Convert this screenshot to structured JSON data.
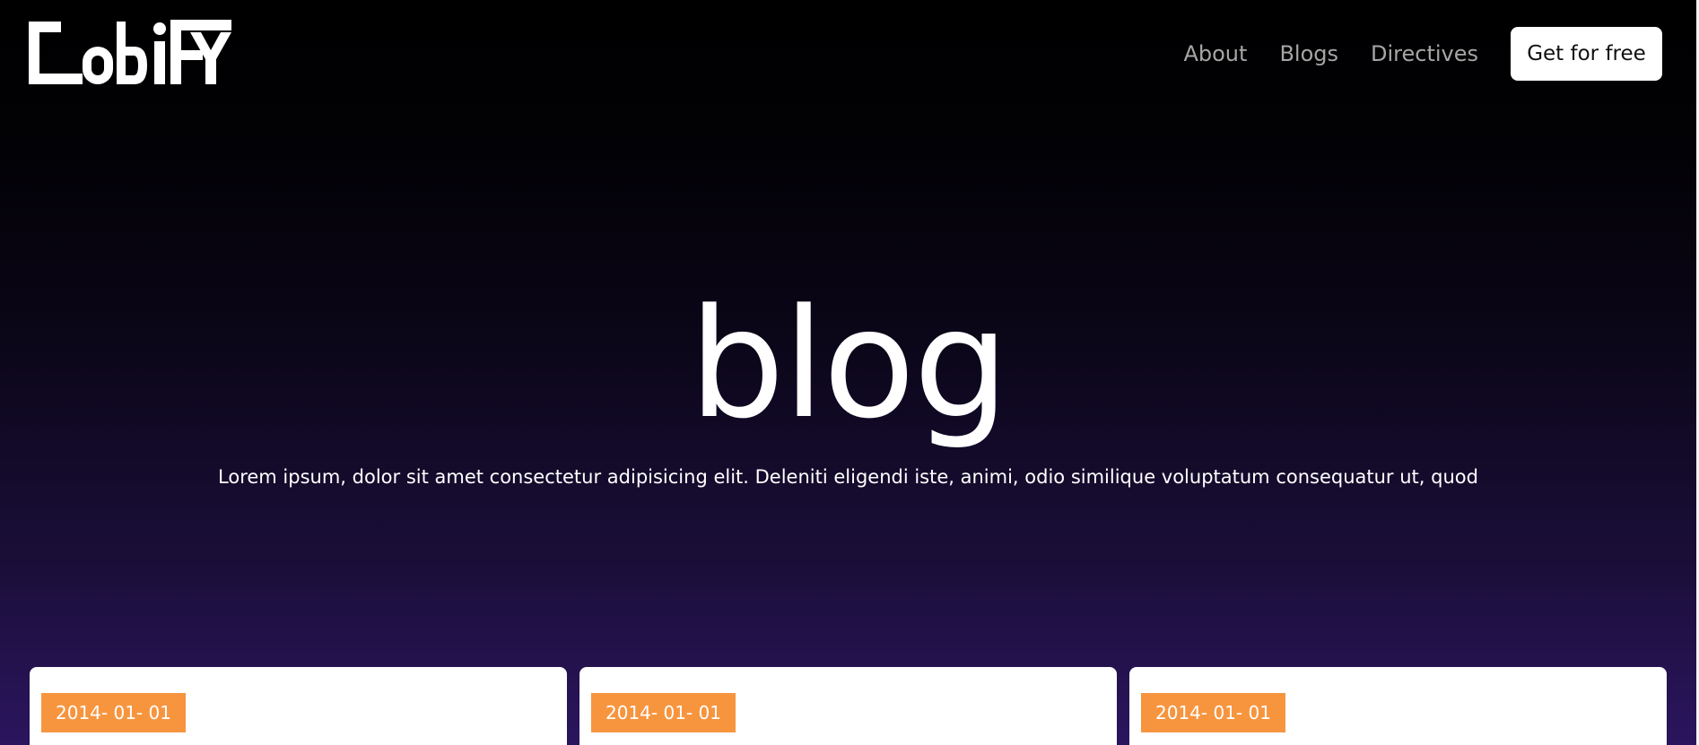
{
  "header": {
    "logo_text": "CODIFY",
    "nav": [
      {
        "label": "About"
      },
      {
        "label": "Blogs"
      },
      {
        "label": "Directives"
      }
    ],
    "cta_label": "Get for free"
  },
  "hero": {
    "title": "blog",
    "subtitle": "Lorem ipsum, dolor sit amet consectetur adipisicing elit. Deleniti eligendi iste, animi, odio similique voluptatum consequatur ut, quod"
  },
  "cards": [
    {
      "date": "2014- 01- 01"
    },
    {
      "date": "2014- 01- 01"
    },
    {
      "date": "2014- 01- 01"
    }
  ],
  "colors": {
    "badge": "#f7953f",
    "gradient_bottom": "#2b155e",
    "background_top": "#000000"
  }
}
